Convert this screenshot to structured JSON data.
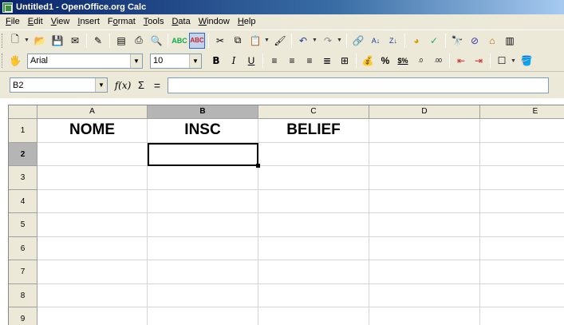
{
  "window": {
    "title": "Untitled1 - OpenOffice.org Calc"
  },
  "menu": [
    {
      "pre": "",
      "ul": "F",
      "post": "ile"
    },
    {
      "pre": "",
      "ul": "E",
      "post": "dit"
    },
    {
      "pre": "",
      "ul": "V",
      "post": "iew"
    },
    {
      "pre": "",
      "ul": "I",
      "post": "nsert"
    },
    {
      "pre": "F",
      "ul": "o",
      "post": "rmat"
    },
    {
      "pre": "",
      "ul": "T",
      "post": "ools"
    },
    {
      "pre": "",
      "ul": "D",
      "post": "ata"
    },
    {
      "pre": "",
      "ul": "W",
      "post": "indow"
    },
    {
      "pre": "",
      "ul": "H",
      "post": "elp"
    }
  ],
  "formatting": {
    "font_name": "Arial",
    "font_size": "10",
    "bold_label": "B",
    "italic_label": "I",
    "underline_label": "U",
    "percent_label": "%",
    "currency_label": "$%"
  },
  "formula_bar": {
    "cell_reference": "B2",
    "fx_label": "f(x)",
    "sum_label": "Σ",
    "equals_label": "=",
    "content": ""
  },
  "sheet": {
    "columns": [
      "A",
      "B",
      "C",
      "D",
      "E"
    ],
    "rows": [
      "1",
      "2",
      "3",
      "4",
      "5",
      "6",
      "7",
      "8",
      "9"
    ],
    "selected_column": "B",
    "selected_row": "2",
    "cells": {
      "A1": "NOME",
      "B1": "INSC",
      "C1": "BELIEF"
    }
  }
}
